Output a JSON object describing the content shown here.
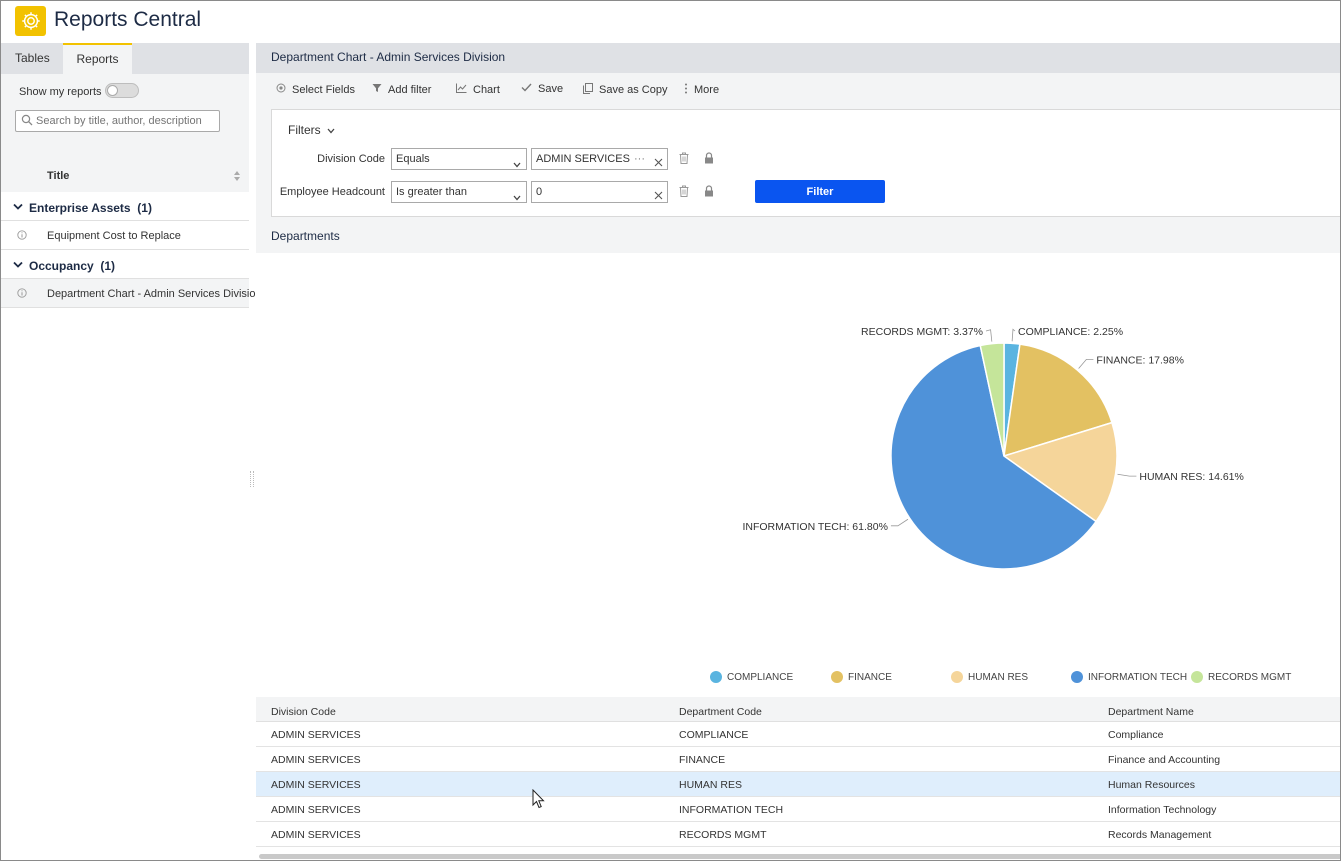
{
  "app": {
    "title": "Reports Central"
  },
  "left": {
    "tabs": [
      {
        "label": "Tables"
      },
      {
        "label": "Reports"
      }
    ],
    "show_my_reports": "Show my reports",
    "search_placeholder": "Search by title, author, description",
    "title_column": "Title",
    "groups": [
      {
        "label": "Enterprise Assets",
        "count": "(1)",
        "items": [
          "Equipment Cost to Replace"
        ]
      },
      {
        "label": "Occupancy",
        "count": "(1)",
        "items": [
          "Department Chart - Admin Services Division"
        ]
      }
    ]
  },
  "main": {
    "title": "Department Chart - Admin Services Division",
    "toolbar": {
      "select_fields": "Select Fields",
      "add_filter": "Add filter",
      "chart": "Chart",
      "save": "Save",
      "save_as_copy": "Save as Copy",
      "more": "More"
    },
    "filters": {
      "label": "Filters",
      "rows": [
        {
          "field": "Division Code",
          "operator": "Equals",
          "value": "ADMIN SERVICES"
        },
        {
          "field": "Employee Headcount",
          "operator": "Is greater than",
          "value": "0"
        }
      ],
      "button": "Filter"
    },
    "section_label": "Departments"
  },
  "chart_data": {
    "type": "pie",
    "slices": [
      {
        "label": "COMPLIANCE",
        "value": 2.25,
        "display": "COMPLIANCE: 2.25%",
        "color": "#5ab4e0"
      },
      {
        "label": "FINANCE",
        "value": 17.98,
        "display": "FINANCE: 17.98%",
        "color": "#e3c162"
      },
      {
        "label": "HUMAN RES",
        "value": 14.61,
        "display": "HUMAN RES: 14.61%",
        "color": "#f5d59a"
      },
      {
        "label": "INFORMATION TECH",
        "value": 61.8,
        "display": "INFORMATION TECH: 61.80%",
        "color": "#4f92d9"
      },
      {
        "label": "RECORDS MGMT",
        "value": 3.37,
        "display": "RECORDS MGMT: 3.37%",
        "color": "#c5e59a"
      }
    ],
    "legend": [
      "COMPLIANCE",
      "FINANCE",
      "HUMAN RES",
      "INFORMATION TECH",
      "RECORDS MGMT"
    ],
    "legend_position": "bottom"
  },
  "table": {
    "columns": [
      "Division Code",
      "Department Code",
      "Department Name"
    ],
    "rows": [
      [
        "ADMIN SERVICES",
        "COMPLIANCE",
        "Compliance"
      ],
      [
        "ADMIN SERVICES",
        "FINANCE",
        "Finance and Accounting"
      ],
      [
        "ADMIN SERVICES",
        "HUMAN RES",
        "Human Resources"
      ],
      [
        "ADMIN SERVICES",
        "INFORMATION TECH",
        "Information Technology"
      ],
      [
        "ADMIN SERVICES",
        "RECORDS MGMT",
        "Records Management"
      ]
    ]
  },
  "colors": {
    "accent": "#f2c200",
    "primary_button": "#0a55f0",
    "row_highlight": "#dfeefc"
  }
}
